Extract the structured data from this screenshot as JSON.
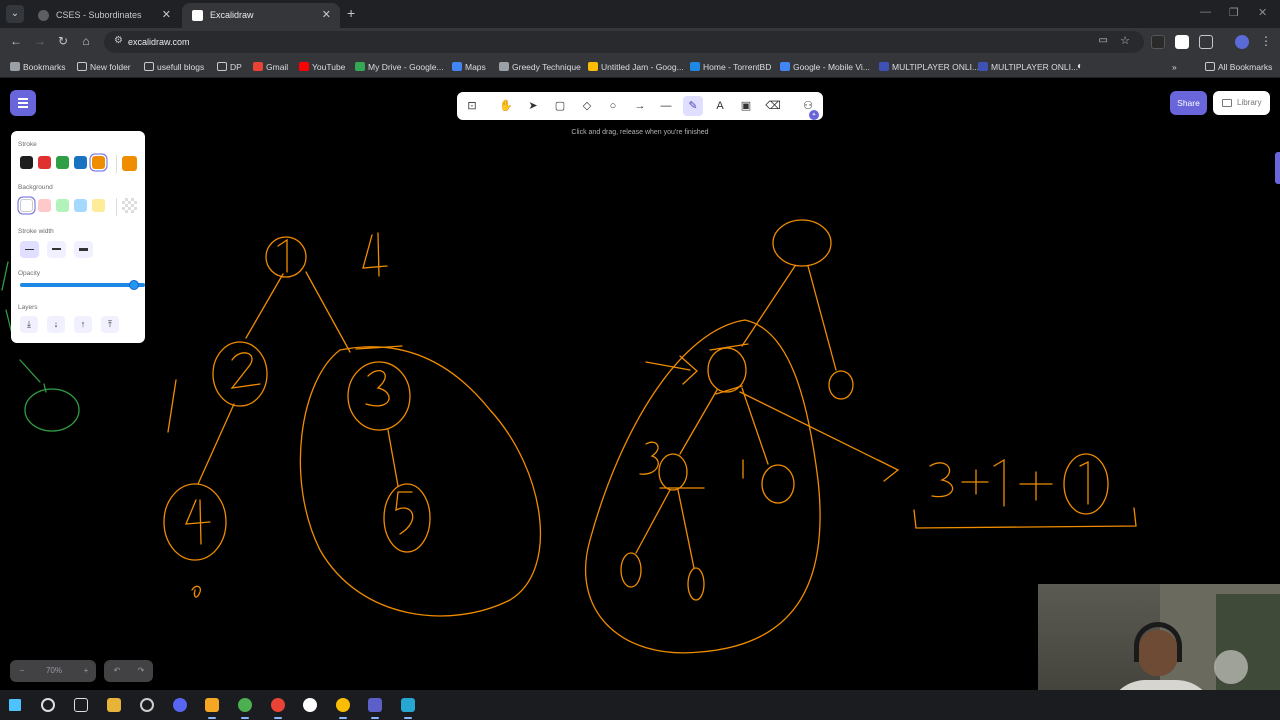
{
  "browser": {
    "tabs": [
      {
        "title": "CSES - Subordinates",
        "active": false
      },
      {
        "title": "Excalidraw",
        "active": true
      }
    ],
    "url": "excalidraw.com",
    "bookmarks": [
      {
        "label": "Bookmarks",
        "icon": "star-icon",
        "color": "#9aa0a6"
      },
      {
        "label": "New folder",
        "icon": "folder-icon",
        "color": "#c5c8cc"
      },
      {
        "label": "usefull blogs",
        "icon": "folder-icon",
        "color": "#c5c8cc"
      },
      {
        "label": "DP",
        "icon": "folder-icon",
        "color": "#c5c8cc"
      },
      {
        "label": "Gmail",
        "icon": "gmail-icon",
        "color": "#ea4335"
      },
      {
        "label": "YouTube",
        "icon": "youtube-icon",
        "color": "#ff0000"
      },
      {
        "label": "My Drive - Google...",
        "icon": "drive-icon",
        "color": "#34a853"
      },
      {
        "label": "Maps",
        "icon": "maps-icon",
        "color": "#4285f4"
      },
      {
        "label": "Greedy Technique",
        "icon": "site-icon",
        "color": "#9aa0a6"
      },
      {
        "label": "Untitled Jam - Goog...",
        "icon": "jam-icon",
        "color": "#fbbc04"
      },
      {
        "label": "Home - TorrentBD",
        "icon": "torrent-icon",
        "color": "#1e88e5"
      },
      {
        "label": "Google - Mobile Vi...",
        "icon": "google-icon",
        "color": "#4285f4"
      },
      {
        "label": "MULTIPLAYER ONLI...",
        "icon": "game-icon",
        "color": "#3f51b5"
      },
      {
        "label": "MULTIPLAYER ONLI...",
        "icon": "game-icon",
        "color": "#3f51b5"
      }
    ],
    "all_bookmarks": "All Bookmarks"
  },
  "excalidraw": {
    "hint": "Click and drag, release when you're finished",
    "share_label": "Share",
    "library_label": "Library",
    "props": {
      "stroke_label": "Stroke",
      "background_label": "Background",
      "stroke_width_label": "Stroke width",
      "opacity_label": "Opacity",
      "layers_label": "Layers",
      "stroke_colors": [
        "#1e1e1e",
        "#e03131",
        "#2f9e44",
        "#1971c2",
        "#f08c00"
      ],
      "selected_stroke": "#f08c00",
      "background_colors": [
        "#ffffff",
        "#ffc9c9",
        "#b2f2bb",
        "#a5d8ff",
        "#ffec99"
      ],
      "opacity_percent": 100
    },
    "zoom": {
      "value": "70%",
      "minus": "−",
      "plus": "+"
    },
    "canvas_text": {
      "root_left_label": "1",
      "node_left_2": "2",
      "node_left_3": "3",
      "node_left_4": "4",
      "node_left_5": "5",
      "count_label": "4",
      "side_mark": "1",
      "bottom_mark": "0",
      "right_sum": "3+1+",
      "right_circle": "1",
      "right_3": "3",
      "right_1": "1"
    },
    "stroke_color": "#f08c00",
    "green_color": "#2f9e44"
  }
}
